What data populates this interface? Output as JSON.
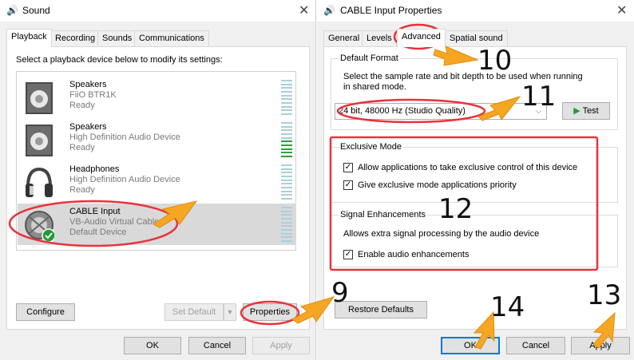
{
  "sound": {
    "title": "Sound",
    "tabs": [
      "Playback",
      "Recording",
      "Sounds",
      "Communications"
    ],
    "instruction": "Select a playback device below to modify its settings:",
    "devices": [
      {
        "name": "Speakers",
        "desc": "FiiO BTR1K",
        "status": "Ready"
      },
      {
        "name": "Speakers",
        "desc": "High Definition Audio Device",
        "status": "Ready"
      },
      {
        "name": "Headphones",
        "desc": "High Definition Audio Device",
        "status": "Ready"
      },
      {
        "name": "CABLE Input",
        "desc": "VB-Audio Virtual Cable",
        "status": "Default Device"
      }
    ],
    "buttons": {
      "configure": "Configure",
      "set_default": "Set Default",
      "properties": "Properties",
      "ok": "OK",
      "cancel": "Cancel",
      "apply": "Apply"
    }
  },
  "props": {
    "title": "CABLE Input Properties",
    "tabs": [
      "General",
      "Levels",
      "Advanced",
      "Spatial sound"
    ],
    "default_format": {
      "title": "Default Format",
      "desc_line1": "Select the sample rate and bit depth to be used when running",
      "desc_line2": "in shared mode.",
      "selected": "24 bit, 48000 Hz (Studio Quality)",
      "test": "Test"
    },
    "exclusive": {
      "title": "Exclusive Mode",
      "opt1": "Allow applications to take exclusive control of this device",
      "opt2": "Give exclusive mode applications priority"
    },
    "signal": {
      "title": "Signal Enhancements",
      "desc": "Allows extra signal processing by the audio device",
      "opt": "Enable audio enhancements"
    },
    "buttons": {
      "restore": "Restore Defaults",
      "ok": "OK",
      "cancel": "Cancel",
      "apply": "Apply"
    }
  },
  "annotations": [
    "9",
    "10",
    "11",
    "12",
    "13",
    "14"
  ],
  "colors": {
    "annotation_red": "#e8323c",
    "annotation_arrow": "#f5a623",
    "check_green": "#1f9d34",
    "accent_blue": "#0078d7"
  }
}
